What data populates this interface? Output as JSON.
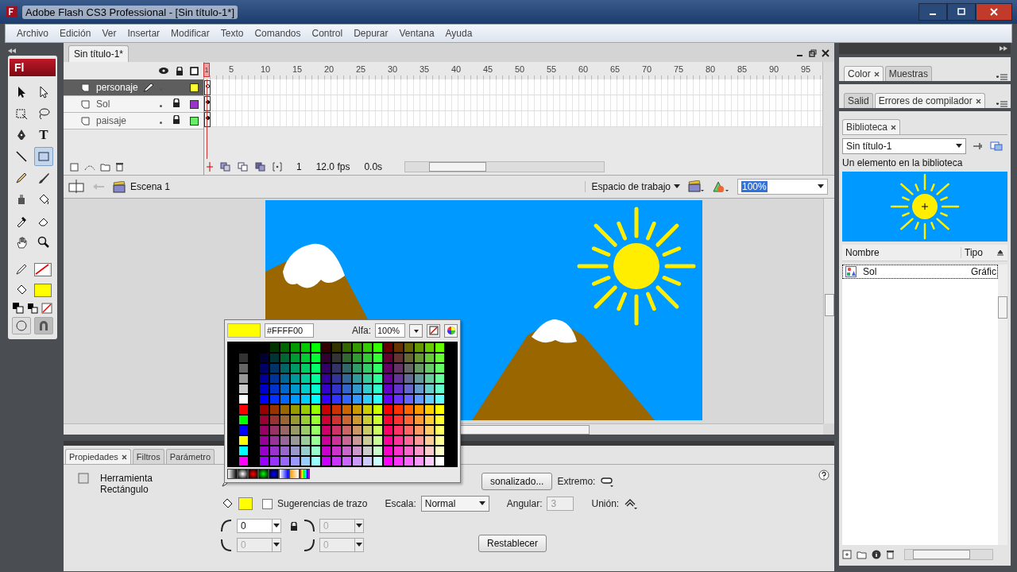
{
  "window": {
    "title": "Adobe Flash CS3 Professional - [Sin título-1*]"
  },
  "menu": [
    "Archivo",
    "Edición",
    "Ver",
    "Insertar",
    "Modificar",
    "Texto",
    "Comandos",
    "Control",
    "Depurar",
    "Ventana",
    "Ayuda"
  ],
  "toolbox": {
    "logo": "Fl",
    "tools": [
      {
        "kind": "arrow",
        "selected": false
      },
      {
        "kind": "subselect",
        "selected": false
      },
      {
        "kind": "transform",
        "selected": false
      },
      {
        "kind": "lasso",
        "selected": false
      },
      {
        "kind": "pen",
        "selected": false
      },
      {
        "kind": "text",
        "glyph": "T",
        "selected": false
      },
      {
        "kind": "line",
        "selected": false
      },
      {
        "kind": "rectangle",
        "selected": true
      },
      {
        "kind": "pencil",
        "selected": false
      },
      {
        "kind": "brush",
        "selected": false
      },
      {
        "kind": "inkbottle",
        "selected": false
      },
      {
        "kind": "bucket",
        "selected": false
      },
      {
        "kind": "eyedropper",
        "selected": false
      },
      {
        "kind": "eraser",
        "selected": false
      },
      {
        "kind": "hand",
        "selected": false
      },
      {
        "kind": "zoom",
        "selected": false
      }
    ]
  },
  "document_tab": "Sin título-1*",
  "timeline": {
    "frame_labels": [
      "1",
      "5",
      "10",
      "15",
      "20",
      "25",
      "30",
      "35",
      "40",
      "45",
      "50",
      "55",
      "60",
      "65",
      "70",
      "75",
      "80",
      "85",
      "90",
      "95"
    ],
    "layers": [
      {
        "name": "personaje",
        "selected": true,
        "editing": true,
        "locked": false,
        "color": "#ffff33",
        "keyframe_filled": false
      },
      {
        "name": "Sol",
        "selected": false,
        "editing": false,
        "locked": true,
        "color": "#9933cc",
        "keyframe_filled": true
      },
      {
        "name": "paisaje",
        "selected": false,
        "editing": false,
        "locked": true,
        "color": "#66ee66",
        "keyframe_filled": true
      }
    ],
    "current_frame": "1",
    "frame_rate": "12.0 fps",
    "elapsed": "0.0s"
  },
  "edit_bar": {
    "scene": "Escena 1",
    "workspace": "Espacio de trabajo",
    "zoom": "100%"
  },
  "color_popup": {
    "hex": "#FFFF00",
    "alpha_label": "Alfa:",
    "alpha": "100%"
  },
  "panels": [
    {
      "tabs": [
        {
          "label": "Color",
          "selected": true,
          "closable": true
        },
        {
          "label": "Muestras",
          "selected": false,
          "closable": false
        }
      ]
    },
    {
      "tabs": [
        {
          "label": "Salid",
          "selected": false,
          "closable": false
        },
        {
          "label": "Errores de compilador",
          "selected": true,
          "closable": true
        }
      ]
    }
  ],
  "library": {
    "tab": "Biblioteca",
    "document": "Sin título-1",
    "summary": "Un elemento en la biblioteca",
    "columns": [
      "Nombre",
      "Tipo"
    ],
    "items": [
      {
        "name": "Sol",
        "type": "Gráfic",
        "selected": true
      }
    ]
  },
  "properties": {
    "tabs": [
      {
        "label": "Propiedades",
        "selected": true,
        "closable": true
      },
      {
        "label": "Filtros",
        "selected": false,
        "closable": false
      },
      {
        "label": "Parámetro",
        "selected": false,
        "closable": false
      }
    ],
    "tool_name": "Herramienta Rectángulo",
    "custom_button": "sonalizado...",
    "cap_label": "Extremo:",
    "hinting": {
      "label": "Sugerencias de trazo",
      "checked": false
    },
    "scale": {
      "label": "Escala:",
      "value": "Normal"
    },
    "miter": {
      "label": "Angular:",
      "value": "3",
      "disabled": true
    },
    "join_label": "Unión:",
    "corners": [
      {
        "value": "0",
        "disabled": false
      },
      {
        "value": "0",
        "disabled": true
      },
      {
        "value": "0",
        "disabled": true
      },
      {
        "value": "0",
        "disabled": true
      }
    ],
    "reset_button": "Restablecer"
  }
}
